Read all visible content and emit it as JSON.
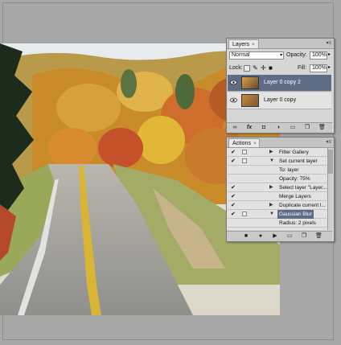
{
  "layers_panel": {
    "tab_label": "Layers",
    "close_glyph": "×",
    "menu_glyph": "▾≡",
    "blend_mode": "Normal",
    "opacity_label": "Opacity:",
    "opacity_value": "100%",
    "lock_label": "Lock:",
    "fill_label": "Fill:",
    "fill_value": "100%",
    "layers": [
      {
        "name": "Layer 0 copy 2",
        "selected": true,
        "visible": true
      },
      {
        "name": "Layer 0 copy",
        "selected": false,
        "visible": true
      }
    ],
    "bottom_icons": [
      "link-icon",
      "fx-icon",
      "mask-icon",
      "adjustment-icon",
      "group-icon",
      "new-layer-icon",
      "trash-icon"
    ]
  },
  "actions_panel": {
    "tab_label": "Actions",
    "close_glyph": "×",
    "items": [
      {
        "text": "Filter Gallery",
        "checked": true,
        "expanded": false,
        "indent": 1,
        "selected": false
      },
      {
        "text": "Set current layer",
        "checked": true,
        "expanded": true,
        "indent": 1,
        "selected": false
      },
      {
        "text": "To: layer",
        "checked": false,
        "expanded": null,
        "indent": 2,
        "selected": false
      },
      {
        "text": "Opacity: 75%",
        "checked": false,
        "expanded": null,
        "indent": 2,
        "selected": false
      },
      {
        "text": "Select layer \"Layer...",
        "checked": true,
        "expanded": false,
        "indent": 1,
        "selected": false
      },
      {
        "text": "Merge Layers",
        "checked": true,
        "expanded": null,
        "indent": 1,
        "selected": false
      },
      {
        "text": "Duplicate current l...",
        "checked": true,
        "expanded": false,
        "indent": 1,
        "selected": false
      },
      {
        "text": "Gaussian Blur",
        "checked": true,
        "expanded": true,
        "indent": 1,
        "selected": true
      },
      {
        "text": "Radius: 2 pixels",
        "checked": false,
        "expanded": null,
        "indent": 2,
        "selected": false
      }
    ],
    "bottom_icons": [
      "stop-icon",
      "record-icon",
      "play-icon",
      "new-set-icon",
      "new-action-icon",
      "trash-icon"
    ]
  },
  "colors": {
    "selection": "#5f6c86",
    "panel_bg": "#d6d6d6"
  }
}
